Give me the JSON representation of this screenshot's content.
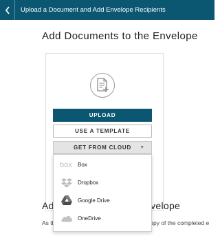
{
  "header": {
    "back_icon": "chevron-left-icon",
    "title": "Upload a Document and Add Envelope Recipients"
  },
  "main": {
    "title": "Add Documents to the Envelope",
    "upload_icon": "document-add-icon",
    "upload_label": "UPLOAD",
    "template_label": "USE A TEMPLATE",
    "cloud_label": "GET FROM CLOUD",
    "cloud_caret_icon": "caret-down-icon"
  },
  "cloud_menu": {
    "items": [
      {
        "label": "Box",
        "icon": "box-logo-icon"
      },
      {
        "label": "Dropbox",
        "icon": "dropbox-logo-icon"
      },
      {
        "label": "Google Drive",
        "icon": "google-drive-logo-icon"
      },
      {
        "label": "OneDrive",
        "icon": "onedrive-logo-icon"
      }
    ]
  },
  "section2": {
    "title_left": "Ad",
    "title_right": "nvelope",
    "text_left": "As th",
    "text_right": "copy of the completed e"
  },
  "colors": {
    "brand": "#0b5772",
    "cloud_button_bg": "#e4e4e4"
  }
}
